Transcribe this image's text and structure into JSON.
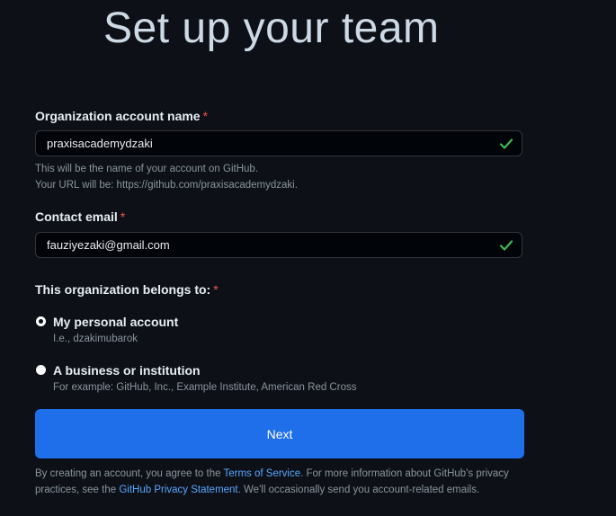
{
  "page": {
    "title": "Set up your team"
  },
  "org_name": {
    "label": "Organization account name",
    "required_mark": "*",
    "value": "praxisacademydzaki",
    "hint_line1": "This will be the name of your account on GitHub.",
    "hint_line2": "Your URL will be: https://github.com/praxisacademydzaki."
  },
  "contact_email": {
    "label": "Contact email",
    "required_mark": "*",
    "value": "fauziyezaki@gmail.com"
  },
  "belongs_to": {
    "label": "This organization belongs to:",
    "required_mark": "*",
    "options": [
      {
        "label": "My personal account",
        "sub": "I.e., dzakimubarok",
        "checked": true
      },
      {
        "label": "A business or institution",
        "sub": "For example: GitHub, Inc., Example Institute, American Red Cross",
        "checked": false
      }
    ]
  },
  "next_button": {
    "label": "Next"
  },
  "terms": {
    "text_1": "By creating an account, you agree to the ",
    "tos_link": "Terms of Service",
    "text_2": ". For more information about GitHub's privacy practices, see the ",
    "privacy_link": "GitHub Privacy Statement",
    "text_3": ". We'll occasionally send you account-related emails."
  },
  "colors": {
    "background": "#0d1117",
    "primary": "#1f6feb",
    "success": "#3fb950",
    "danger": "#f85149",
    "link": "#58a6ff"
  },
  "icons": {
    "valid": "check-icon"
  }
}
